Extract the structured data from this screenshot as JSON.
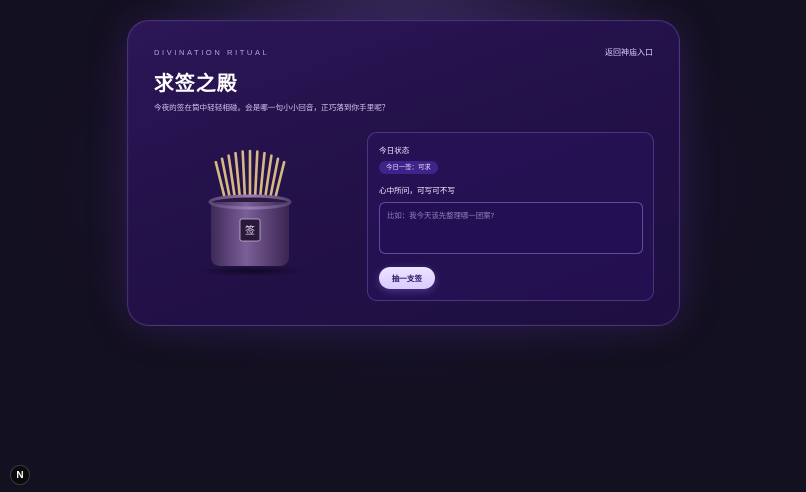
{
  "header": {
    "eyebrow": "DIVINATION RITUAL",
    "back_link": "返回神庙入口",
    "title": "求签之殿",
    "subtitle": "今夜的签在筒中轻轻相碰。会是哪一句小小回音，正巧落到你手里呢？"
  },
  "illustration": {
    "jar_char": "签",
    "stick_count": 11
  },
  "panel": {
    "status_label": "今日状态",
    "status_badge": "今日一签：可求",
    "wish_label": "心中所问，可写可不写",
    "wish_value": "",
    "wish_placeholder": "比如：我今天该先整理哪一团案?",
    "draw_button": "抽一支签"
  },
  "dev_badge": "N",
  "colors": {
    "background": "#13101f",
    "card": "#231149",
    "panel": "#28125c",
    "badge": "#3f2389",
    "button": "#e4dbff",
    "stick": "#d8b882",
    "jar": "#6a4f86"
  }
}
